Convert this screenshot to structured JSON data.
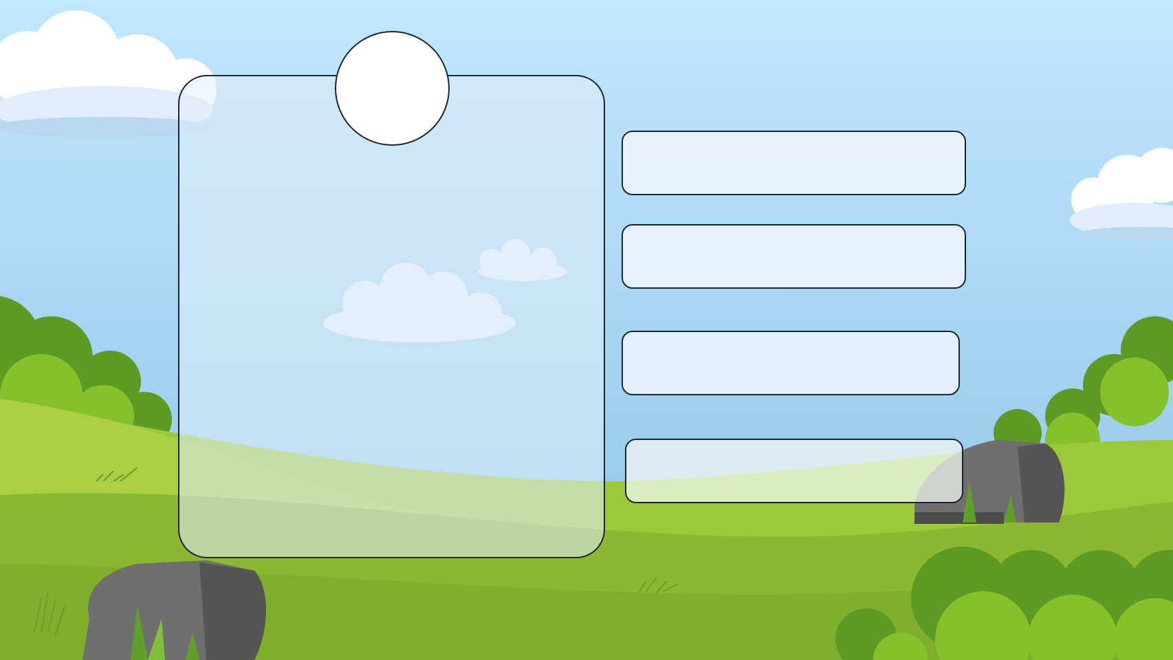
{
  "scene": {
    "background": "meadow-with-clouds",
    "sky_top": "#bfe6fb",
    "sky_bottom": "#8cc2e6",
    "grass_light": "#a6cd3a",
    "grass_dark": "#7fae2b",
    "bush": "#6aa62b",
    "rock": "#6e6e6e"
  },
  "question_panel": {
    "text": "",
    "image_label": ""
  },
  "options": [
    {
      "label": ""
    },
    {
      "label": ""
    },
    {
      "label": ""
    },
    {
      "label": ""
    }
  ]
}
